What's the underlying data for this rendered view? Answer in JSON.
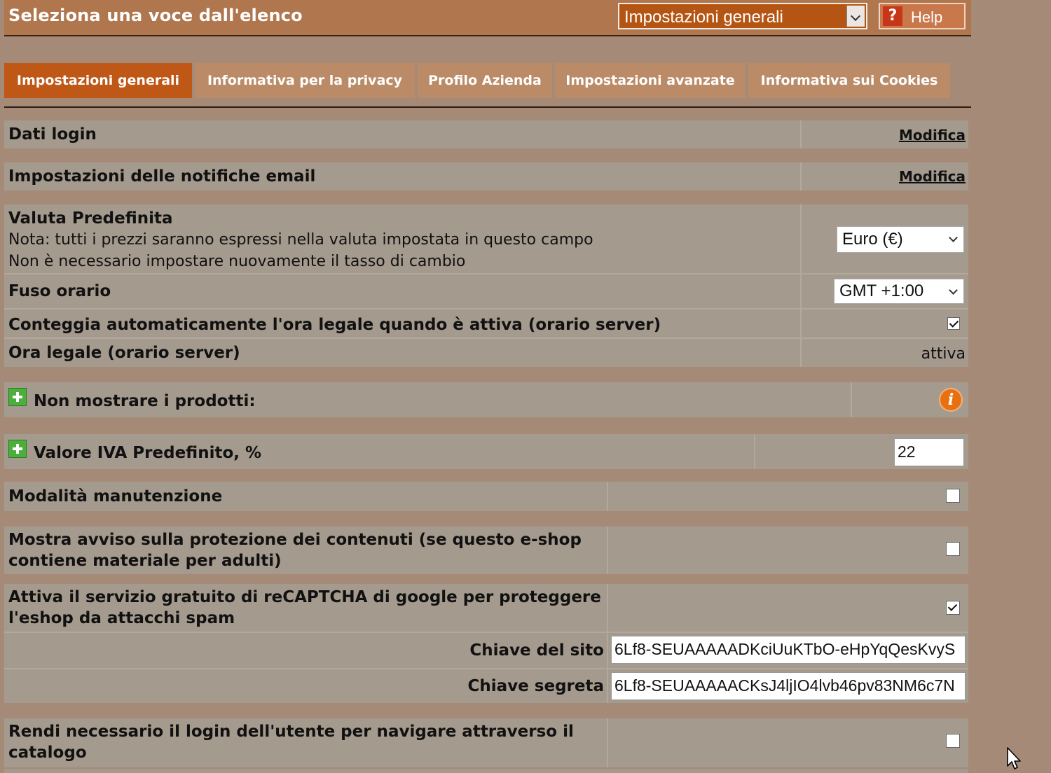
{
  "header": {
    "title": "Seleziona una voce dall'elenco",
    "section_select_value": "Impostazioni generali",
    "help_label": "Help",
    "help_icon": "?"
  },
  "tabs": [
    {
      "label": "Impostazioni generali",
      "active": true
    },
    {
      "label": "Informativa per la privacy",
      "active": false
    },
    {
      "label": "Profilo Azienda",
      "active": false
    },
    {
      "label": "Impostazioni avanzate",
      "active": false
    },
    {
      "label": "Informativa sui Cookies",
      "active": false
    }
  ],
  "settings": {
    "login_data": {
      "label": "Dati login",
      "action": "Modifica"
    },
    "email_notifications": {
      "label": "Impostazioni delle notifiche email",
      "action": "Modifica"
    },
    "default_currency": {
      "label": "Valuta Predefinita",
      "note1": "Nota: tutti i prezzi saranno espressi nella valuta impostata in questo campo",
      "note2": "Non è necessario impostare nuovamente il tasso di cambio",
      "value": "Euro (€)"
    },
    "timezone": {
      "label": "Fuso orario",
      "value": "GMT +1:00"
    },
    "auto_dst": {
      "label": "Conteggia automaticamente l'ora legale quando è attiva (orario server)",
      "checked": true
    },
    "dst_status": {
      "label": "Ora legale (orario server)",
      "value": "attiva"
    },
    "hide_products": {
      "label": "Non mostrare i prodotti:",
      "info_icon": "i"
    },
    "default_vat": {
      "label": "Valore IVA Predefinito, %",
      "value": "22"
    },
    "maintenance": {
      "label": "Modalità manutenzione",
      "checked": false
    },
    "adult_warning": {
      "label_line1": "Mostra avviso sulla protezione dei contenuti (se questo e-shop",
      "label_line2": "contiene materiale per adulti)",
      "checked": false
    },
    "recaptcha": {
      "label_line1": "Attiva il servizio gratuito di reCAPTCHA di google per proteggere",
      "label_line2": "l'eshop da attacchi spam",
      "checked": true,
      "site_key_label": "Chiave del sito",
      "site_key_value": "6Lf8-SEUAAAAADKciUuKTbO-eHpYqQesKvyS",
      "secret_key_label": "Chiave segreta",
      "secret_key_value": "6Lf8-SEUAAAAACKsJ4ljIO4lvb46pv83NM6c7N"
    },
    "require_login": {
      "label_line1": "Rendi necessario il login dell'utente per navigare attraverso il",
      "label_line2": "catalogo",
      "checked": false
    }
  },
  "colors": {
    "background": "#a68a78",
    "header": "#b0764e",
    "active_tab": "#bf5717",
    "tab": "#bb8b68",
    "row": "#a59a8e"
  }
}
